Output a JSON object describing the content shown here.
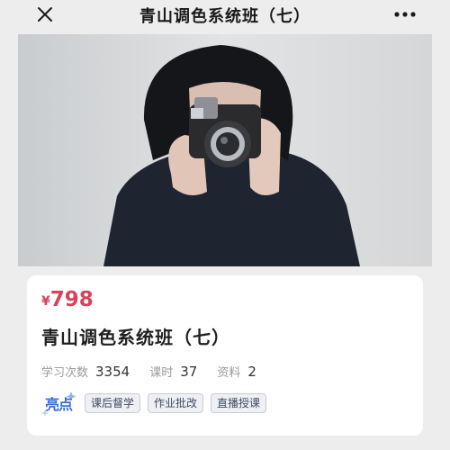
{
  "navbar": {
    "title": "青山调色系统班（七）",
    "close_icon": "close-icon",
    "more_icon": "more-dots-icon"
  },
  "hero": {
    "image": "photo of a woman in a dark sweater holding an instant camera in front of her face"
  },
  "course": {
    "price_currency": "¥",
    "price_value": "798",
    "title": "青山调色系统班（七）",
    "stats": [
      {
        "label": "学习次数",
        "value": "3354"
      },
      {
        "label": "课时",
        "value": "37"
      },
      {
        "label": "资料",
        "value": "2"
      }
    ],
    "highlight_label": "亮点",
    "tags": [
      "课后督学",
      "作业批改",
      "直播授课"
    ]
  },
  "colors": {
    "price": "#d8435a",
    "highlight": "#3b6cd6",
    "background": "#ededed"
  }
}
